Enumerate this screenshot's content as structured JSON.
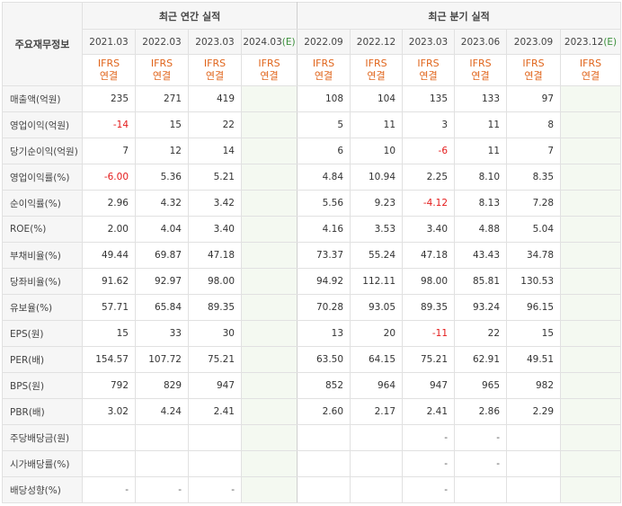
{
  "header": {
    "corner_label": "주요재무정보",
    "annual_title": "최근 연간 실적",
    "quarter_title": "최근 분기 실적"
  },
  "periods": [
    {
      "label": "2021.03",
      "type": "IFRS",
      "basis": "연결",
      "estimate": false
    },
    {
      "label": "2022.03",
      "type": "IFRS",
      "basis": "연결",
      "estimate": false
    },
    {
      "label": "2023.03",
      "type": "IFRS",
      "basis": "연결",
      "estimate": false
    },
    {
      "label": "2024.03",
      "estimate_mark": "(E)",
      "type": "IFRS",
      "basis": "연결",
      "estimate": true
    },
    {
      "label": "2022.09",
      "type": "IFRS",
      "basis": "연결",
      "estimate": false
    },
    {
      "label": "2022.12",
      "type": "IFRS",
      "basis": "연결",
      "estimate": false
    },
    {
      "label": "2023.03",
      "type": "IFRS",
      "basis": "연결",
      "estimate": false
    },
    {
      "label": "2023.06",
      "type": "IFRS",
      "basis": "연결",
      "estimate": false
    },
    {
      "label": "2023.09",
      "type": "IFRS",
      "basis": "연결",
      "estimate": false
    },
    {
      "label": "2023.12",
      "estimate_mark": "(E)",
      "type": "IFRS",
      "basis": "연결",
      "estimate": true
    }
  ],
  "rows": [
    {
      "label": "매출액(억원)",
      "values": [
        "235",
        "271",
        "419",
        "",
        "108",
        "104",
        "135",
        "133",
        "97",
        ""
      ]
    },
    {
      "label": "영업이익(억원)",
      "values": [
        "-14",
        "15",
        "22",
        "",
        "5",
        "11",
        "3",
        "11",
        "8",
        ""
      ]
    },
    {
      "label": "당기순이익(억원)",
      "values": [
        "7",
        "12",
        "14",
        "",
        "6",
        "10",
        "-6",
        "11",
        "7",
        ""
      ]
    },
    {
      "label": "영업이익률(%)",
      "values": [
        "-6.00",
        "5.36",
        "5.21",
        "",
        "4.84",
        "10.94",
        "2.25",
        "8.10",
        "8.35",
        ""
      ]
    },
    {
      "label": "순이익률(%)",
      "values": [
        "2.96",
        "4.32",
        "3.42",
        "",
        "5.56",
        "9.23",
        "-4.12",
        "8.13",
        "7.28",
        ""
      ]
    },
    {
      "label": "ROE(%)",
      "values": [
        "2.00",
        "4.04",
        "3.40",
        "",
        "4.16",
        "3.53",
        "3.40",
        "4.88",
        "5.04",
        ""
      ]
    },
    {
      "label": "부채비율(%)",
      "values": [
        "49.44",
        "69.87",
        "47.18",
        "",
        "73.37",
        "55.24",
        "47.18",
        "43.43",
        "34.78",
        ""
      ]
    },
    {
      "label": "당좌비율(%)",
      "values": [
        "91.62",
        "92.97",
        "98.00",
        "",
        "94.92",
        "112.11",
        "98.00",
        "85.81",
        "130.53",
        ""
      ]
    },
    {
      "label": "유보율(%)",
      "values": [
        "57.71",
        "65.84",
        "89.35",
        "",
        "70.28",
        "93.05",
        "89.35",
        "93.24",
        "96.15",
        ""
      ]
    },
    {
      "label": "EPS(원)",
      "values": [
        "15",
        "33",
        "30",
        "",
        "13",
        "20",
        "-11",
        "22",
        "15",
        ""
      ]
    },
    {
      "label": "PER(배)",
      "values": [
        "154.57",
        "107.72",
        "75.21",
        "",
        "63.50",
        "64.15",
        "75.21",
        "62.91",
        "49.51",
        ""
      ]
    },
    {
      "label": "BPS(원)",
      "values": [
        "792",
        "829",
        "947",
        "",
        "852",
        "964",
        "947",
        "965",
        "982",
        ""
      ]
    },
    {
      "label": "PBR(배)",
      "values": [
        "3.02",
        "4.24",
        "2.41",
        "",
        "2.60",
        "2.17",
        "2.41",
        "2.86",
        "2.29",
        ""
      ]
    },
    {
      "label": "주당배당금(원)",
      "values": [
        "",
        "",
        "",
        "",
        "",
        "",
        "-",
        "-",
        "",
        ""
      ]
    },
    {
      "label": "시가배당률(%)",
      "values": [
        "",
        "",
        "",
        "",
        "",
        "",
        "-",
        "-",
        "",
        ""
      ]
    },
    {
      "label": "배당성향(%)",
      "values": [
        "-",
        "-",
        "-",
        "",
        "",
        "",
        "-",
        "",
        "",
        ""
      ]
    }
  ],
  "colors": {
    "negative": "#e41b1b",
    "ifrs_text": "#e0651c",
    "estimate_bg": "#f4f9f1",
    "estimate_mark": "#3a8f3a"
  }
}
